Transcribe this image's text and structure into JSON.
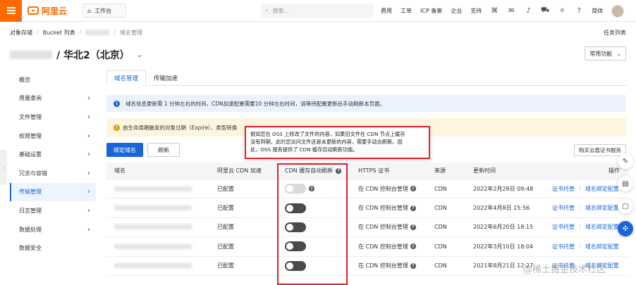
{
  "topbar": {
    "logo_text": "阿里云",
    "workbench": "工作台",
    "search_placeholder": "搜索...",
    "nav": [
      "费用",
      "工单",
      "ICP 备案",
      "企业",
      "支持"
    ],
    "lang": "简体"
  },
  "breadcrumb": [
    "对象存储",
    "Bucket 列表",
    "域名管理"
  ],
  "task_list": "任务列表",
  "page_title": "/ 华北2（北京）",
  "common_functions": "常用功能",
  "sidebar": {
    "items": [
      {
        "label": "概览",
        "chevron": false
      },
      {
        "label": "用量查询",
        "chevron": true
      },
      {
        "label": "文件管理",
        "chevron": true
      },
      {
        "label": "权限管理",
        "chevron": true
      },
      {
        "label": "基础设置",
        "chevron": true
      },
      {
        "label": "冗余与容错",
        "chevron": true
      },
      {
        "label": "传输管理",
        "chevron": true,
        "active": true
      },
      {
        "label": "日志管理",
        "chevron": true
      },
      {
        "label": "数据处理",
        "chevron": true
      },
      {
        "label": "数据安全",
        "chevron": false
      }
    ]
  },
  "tabs": [
    "域名管理",
    "传输加速"
  ],
  "info_text": "域名信息更新需 1 分钟左右的时间，CDN加速配置需要10 分钟左右时间，请等待配置更新后手动刷新本页面。",
  "warn_text": "由生命周期触发的对象过期（Expire）、类型转换",
  "buttons": {
    "bind_domain": "绑定域名",
    "refresh": "刷新",
    "buy_cert": "购买云盾证书服务"
  },
  "tooltip": {
    "line1": "假如您在 OSS 上修改了文件的内容，如果旧文件在 CDN 节点上缓存",
    "line2": "没有到期，此时您访问文件还是未更新的内容，需要手动去刷新。因",
    "line3": "此，OSS 服务提供了 CDN 缓存自动刷新功能。"
  },
  "table": {
    "headers": {
      "domain": "域名",
      "cdn": "阿里云 CDN 加速",
      "refresh": "CDN 缓存自动刷新",
      "https": "HTTPS 证书",
      "source": "来源",
      "updated": "更新时间",
      "ops": "操作"
    },
    "rows": [
      {
        "cdn": "已配置",
        "auto_refresh": false,
        "https": "在 CDN 控制台管理",
        "source": "CDN",
        "updated": "2022年2月28日 09:48",
        "op1": "证书托管",
        "op2": "域名绑定配置"
      },
      {
        "cdn": "已配置",
        "auto_refresh": true,
        "https": "在 CDN 控制台管理",
        "source": "CDN",
        "updated": "2022年4月8日 15:56",
        "op1": "证书托管",
        "op2": "域名绑定配置"
      },
      {
        "cdn": "已配置",
        "auto_refresh": true,
        "https": "在 CDN 控制台管理",
        "source": "CDN",
        "updated": "2022年6月20日 18:15",
        "op1": "证书托管",
        "op2": "域名绑定配置"
      },
      {
        "cdn": "已配置",
        "auto_refresh": true,
        "https": "在 CDN 控制台管理",
        "source": "CDN",
        "updated": "2022年3月10日 18:04",
        "op1": "证书托管",
        "op2": "域名绑定配置"
      },
      {
        "cdn": "已配置",
        "auto_refresh": true,
        "https": "在 CDN 控制台管理",
        "source": "CDN",
        "updated": "2021年8月21日 12:27",
        "op1": "证书托管",
        "op2": "域名绑定配置"
      }
    ]
  },
  "watermark": "@稀土掘金技术社区"
}
